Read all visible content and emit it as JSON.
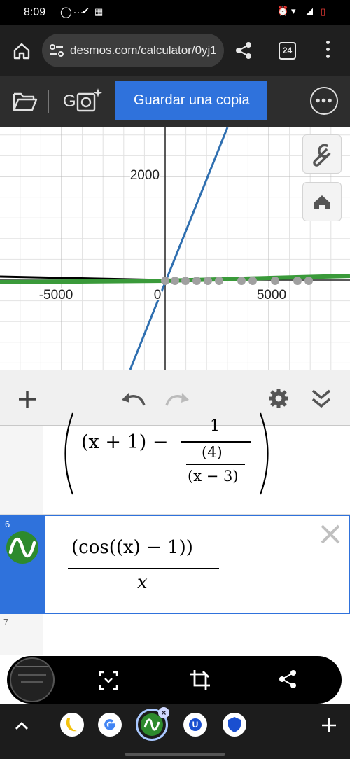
{
  "status": {
    "time": "8:09",
    "left_icons": [
      "game-icon",
      "more-dots-icon",
      "check-circle-icon",
      "image-icon"
    ],
    "right_icons": [
      "alarm-icon",
      "wifi-icon",
      "signal-icon",
      "battery-icon"
    ]
  },
  "browser": {
    "url": "desmos.com/calculator/0yj1",
    "tab_count": "24"
  },
  "desmos_toolbar": {
    "logo_text": "G",
    "save_label": "Guardar una copia"
  },
  "graph": {
    "y_tick": "2000",
    "x_ticks": [
      "-5000",
      "0",
      "5000"
    ]
  },
  "expressions": [
    {
      "index": "",
      "parts": {
        "a": "(x + 1) −",
        "num": "1",
        "den_num": "(4)",
        "den_den": "(x − 3)"
      }
    },
    {
      "index": "6",
      "numerator": "(cos((x) − 1))",
      "denominator": "x",
      "color": "#2d8a2d"
    },
    {
      "index": "7"
    }
  ],
  "colors": {
    "accent": "#2f72dc",
    "line_blue": "#2f6fb0",
    "line_green": "#3a9a3a",
    "line_black": "#000000",
    "points_gray": "#a0a0a0"
  }
}
